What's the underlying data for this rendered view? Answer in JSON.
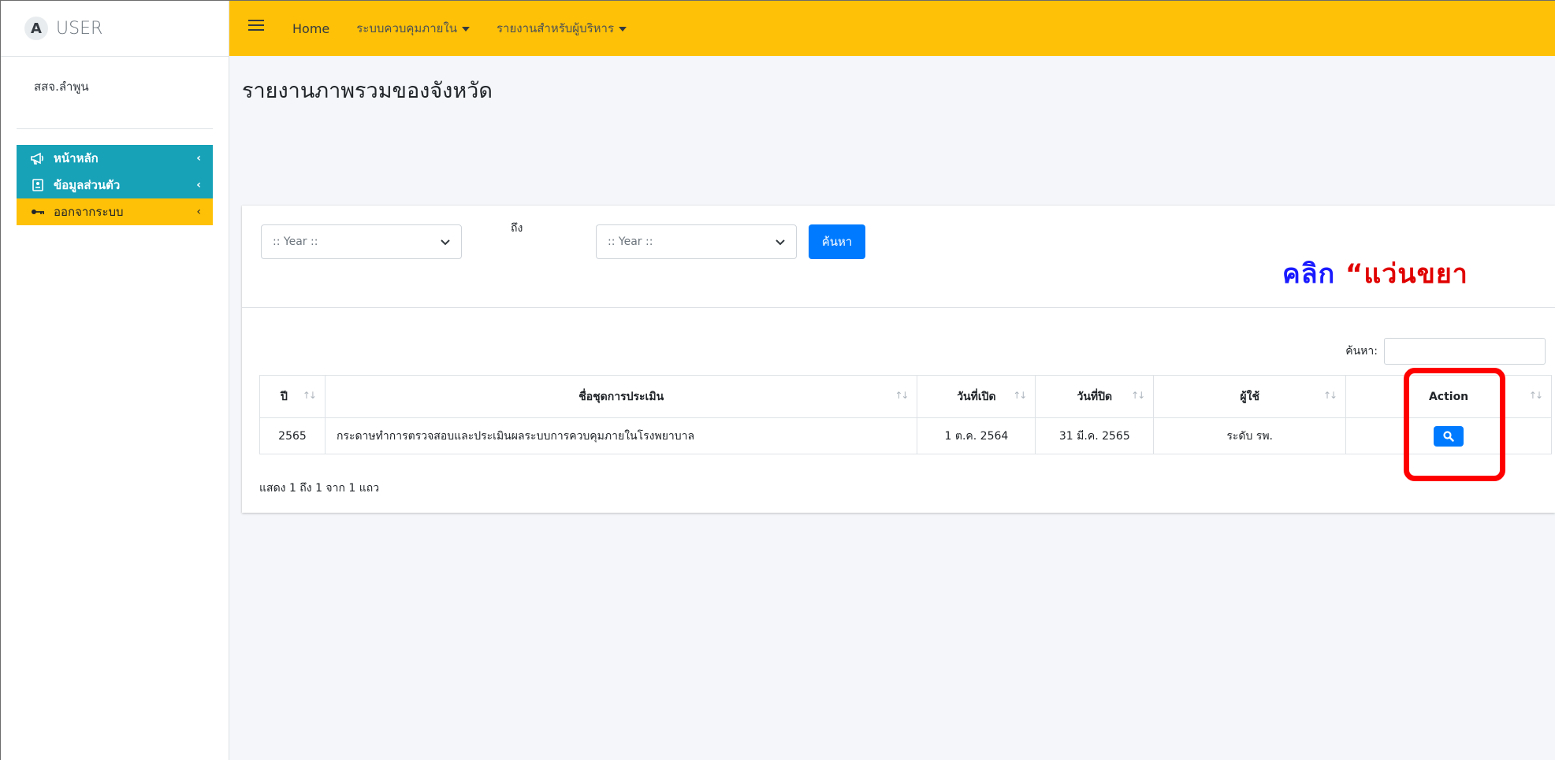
{
  "brand": {
    "logo_letter": "A",
    "name": "USER"
  },
  "user": {
    "name": "สสจ.ลำพูน"
  },
  "sidebar": {
    "items": [
      {
        "label": "หน้าหลัก",
        "icon": "megaphone-icon",
        "color": "#17a2b8"
      },
      {
        "label": "ข้อมูลส่วนตัว",
        "icon": "id-card-icon",
        "color": "#17a2b8"
      },
      {
        "label": "ออกจากระบบ",
        "icon": "key-icon",
        "color": "#ffc107"
      }
    ]
  },
  "topnav": {
    "home": "Home",
    "menu1": "ระบบควบคุมภายใน",
    "menu2": "รายงานสำหรับผู้บริหาร",
    "color": "#ffc107"
  },
  "page": {
    "title": "รายงานภาพรวมของจังหวัด"
  },
  "filter": {
    "year_from": ":: Year ::",
    "to_label": "ถึง",
    "year_to": ":: Year ::",
    "search_button": "ค้นหา"
  },
  "datatable": {
    "search_label": "ค้นหา:",
    "columns": [
      "ปี",
      "ชื่อชุดการประเมิน",
      "วันที่เปิด",
      "วันที่ปิด",
      "ผู้ใช้",
      "Action"
    ],
    "rows": [
      {
        "year": "2565",
        "name": "กระดาษทำการตรวจสอบและประเมินผลระบบการควบคุมภายในโรงพยาบาล",
        "open_date": "1 ต.ค. 2564",
        "close_date": "31 มี.ค. 2565",
        "user": "ระดับ รพ.",
        "action_icon": "search-icon"
      }
    ],
    "info": "แสดง 1 ถึง 1 จาก 1 แถว"
  },
  "annotation": {
    "prefix": "คลิก ",
    "quoted": "“แว่นขยา"
  }
}
